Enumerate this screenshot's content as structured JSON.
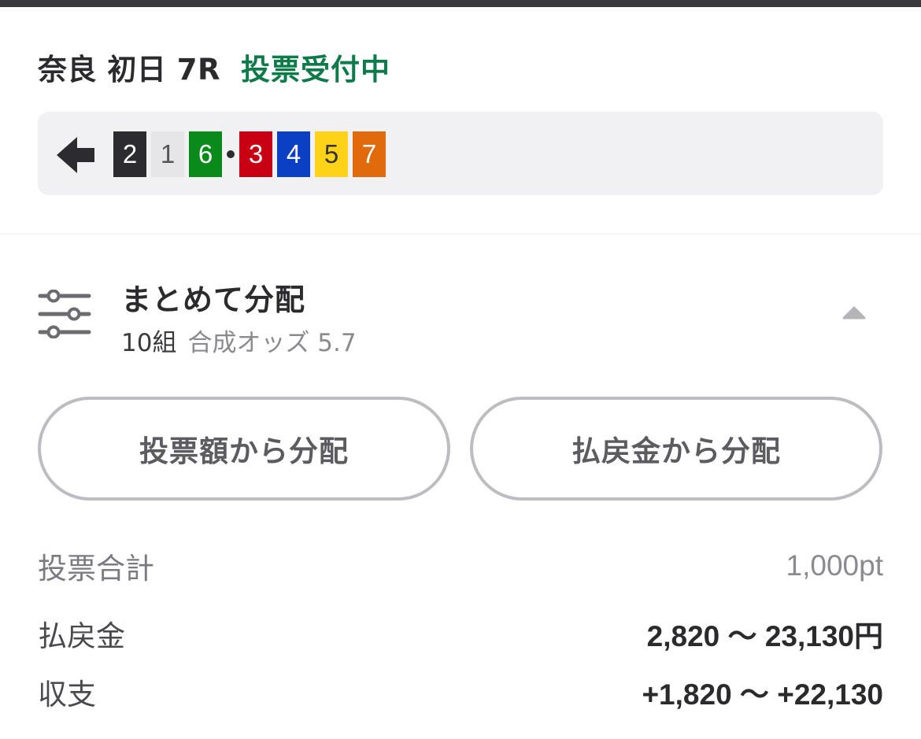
{
  "race": {
    "title": "奈良 初日 7R",
    "status": "投票受付中"
  },
  "bet": {
    "arrow_icon": "left-arrow-icon",
    "numbers": [
      {
        "label": "2",
        "color": "#2c2c30"
      },
      {
        "label": "1",
        "color": "#e6e6e9"
      },
      {
        "label": "6",
        "color": "#0b8a1c"
      },
      {
        "separator": "•"
      },
      {
        "label": "3",
        "color": "#c90014"
      },
      {
        "label": "4",
        "color": "#0b3fc4"
      },
      {
        "label": "5",
        "color": "#ffd21a"
      },
      {
        "label": "7",
        "color": "#e06a0c"
      }
    ]
  },
  "distribution": {
    "icon": "sliders-icon",
    "title": "まとめて分配",
    "count": "10組",
    "odds": "合成オッズ 5.7",
    "toggle_icon": "caret-up-icon",
    "buttons": {
      "by_amount": "投票額から分配",
      "by_payout": "払戻金から分配"
    }
  },
  "summary": {
    "total_label": "投票合計",
    "total_value": "1,000pt",
    "payout_label": "払戻金",
    "payout_value": "2,820 〜 23,130円",
    "profit_label": "収支",
    "profit_value": "+1,820 〜 +22,130"
  },
  "colors": {
    "status_green": "#0e7a4a",
    "box_bg": "#f1f1f4",
    "pill_border": "#bcbcc1"
  }
}
